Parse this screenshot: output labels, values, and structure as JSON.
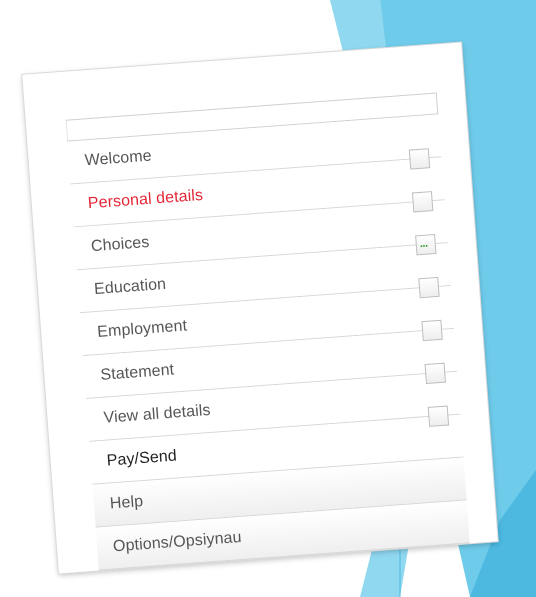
{
  "nav": {
    "items": [
      {
        "label": "Welcome",
        "status": "none"
      },
      {
        "label": "Personal details",
        "status": "empty",
        "active": true
      },
      {
        "label": "Choices",
        "status": "empty"
      },
      {
        "label": "Education",
        "status": "in-progress",
        "status_text": "..."
      },
      {
        "label": "Employment",
        "status": "empty"
      },
      {
        "label": "Statement",
        "status": "empty"
      },
      {
        "label": "View all details",
        "status": "empty"
      },
      {
        "label": "Pay/Send",
        "status": "empty"
      },
      {
        "label": "Help",
        "status": "none"
      },
      {
        "label": "Options/Opsiynau",
        "status": "none"
      }
    ]
  },
  "colors": {
    "active_text": "#e32636",
    "text": "#555555",
    "in_progress": "#2e9c2e",
    "background_accent": "#6ecbea"
  }
}
